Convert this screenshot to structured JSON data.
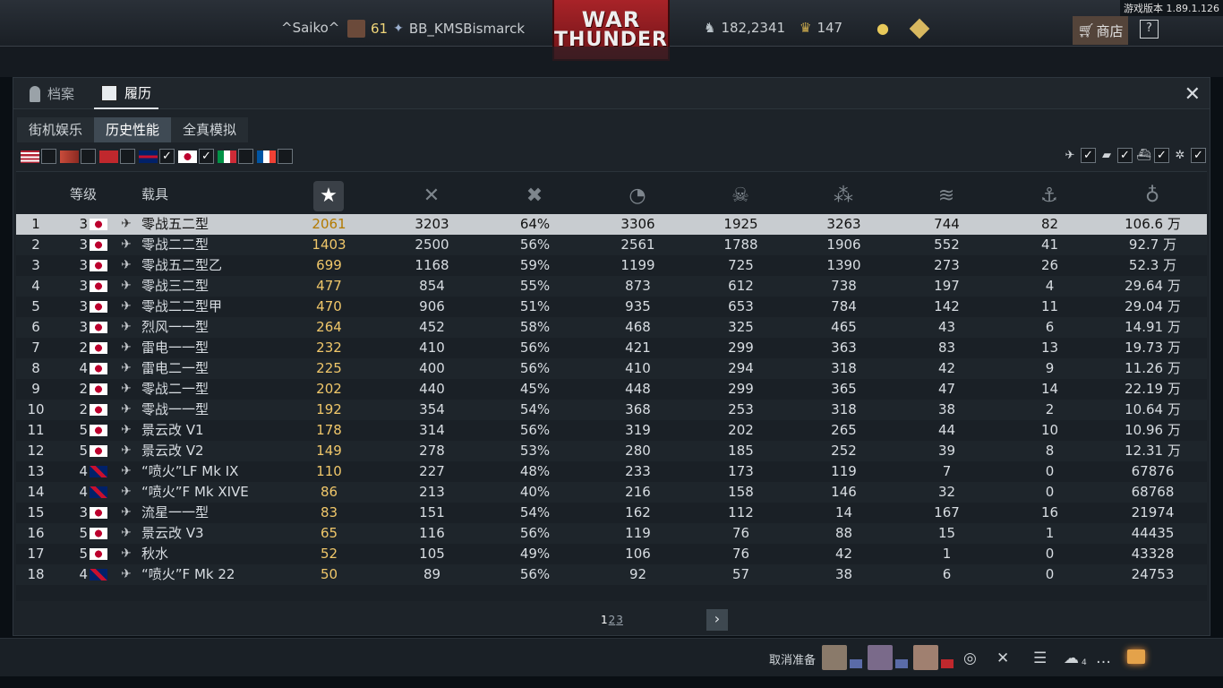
{
  "version": "游戏版本 1.89.1.126",
  "topbar": {
    "nickname": "^Saiko^",
    "rank": "61",
    "player_name": "BB_KMSBismarck",
    "logo_line1": "WAR",
    "logo_line2": "THUNDER",
    "silver": "182,2341",
    "gold": "147",
    "shop_label": "商店",
    "help_label": "?"
  },
  "window": {
    "tabs": [
      "档案",
      "履历"
    ],
    "active_tab": "履历",
    "close_label": "✕",
    "modes": [
      "街机娱乐",
      "历史性能",
      "全真模拟"
    ],
    "active_mode": "历史性能",
    "nation_filters": [
      {
        "icon": "usa-flag-icon",
        "checked": false
      },
      {
        "icon": "germany-flag-icon",
        "checked": false
      },
      {
        "icon": "ussr-flag-icon",
        "checked": false
      },
      {
        "icon": "uk-flag-icon",
        "checked": true
      },
      {
        "icon": "japan-flag-icon",
        "checked": true
      },
      {
        "icon": "italy-flag-icon",
        "checked": false
      },
      {
        "icon": "france-flag-icon",
        "checked": false
      }
    ],
    "type_filters": [
      {
        "icon": "aircraft-icon",
        "checked": true
      },
      {
        "icon": "tank-icon",
        "checked": true
      },
      {
        "icon": "ship-icon",
        "checked": true
      },
      {
        "icon": "helicopter-icon",
        "checked": true
      }
    ],
    "check_glyph": "✓",
    "headers": {
      "tier": "等级",
      "vehicle": "载具",
      "columns": [
        "battles-icon",
        "respawns-icon",
        "victories-pct-icon",
        "flights-icon",
        "deaths-icon",
        "air-kills-icon",
        "ground-kills-icon",
        "naval-kills-icon",
        "score-icon"
      ]
    },
    "rows": [
      {
        "idx": "1",
        "tier": "3",
        "nation": "japan",
        "name": "零战五二型",
        "v": [
          "2061",
          "3203",
          "64%",
          "3306",
          "1925",
          "3263",
          "744",
          "82",
          "106.6 万"
        ]
      },
      {
        "idx": "2",
        "tier": "3",
        "nation": "japan",
        "name": "零战二二型",
        "v": [
          "1403",
          "2500",
          "56%",
          "2561",
          "1788",
          "1906",
          "552",
          "41",
          "92.7 万"
        ]
      },
      {
        "idx": "3",
        "tier": "3",
        "nation": "japan",
        "name": "零战五二型乙",
        "v": [
          "699",
          "1168",
          "59%",
          "1199",
          "725",
          "1390",
          "273",
          "26",
          "52.3 万"
        ]
      },
      {
        "idx": "4",
        "tier": "3",
        "nation": "japan",
        "name": "零战三二型",
        "v": [
          "477",
          "854",
          "55%",
          "873",
          "612",
          "738",
          "197",
          "4",
          "29.64 万"
        ]
      },
      {
        "idx": "5",
        "tier": "3",
        "nation": "japan",
        "name": "零战二二型甲",
        "v": [
          "470",
          "906",
          "51%",
          "935",
          "653",
          "784",
          "142",
          "11",
          "29.04 万"
        ]
      },
      {
        "idx": "6",
        "tier": "3",
        "nation": "japan",
        "name": "烈风一一型",
        "v": [
          "264",
          "452",
          "58%",
          "468",
          "325",
          "465",
          "43",
          "6",
          "14.91 万"
        ]
      },
      {
        "idx": "7",
        "tier": "2",
        "nation": "japan",
        "name": "雷电一一型",
        "v": [
          "232",
          "410",
          "56%",
          "421",
          "299",
          "363",
          "83",
          "13",
          "19.73 万"
        ]
      },
      {
        "idx": "8",
        "tier": "4",
        "nation": "japan",
        "name": "雷电二一型",
        "v": [
          "225",
          "400",
          "56%",
          "410",
          "294",
          "318",
          "42",
          "9",
          "11.26 万"
        ]
      },
      {
        "idx": "9",
        "tier": "2",
        "nation": "japan",
        "name": "零战二一型",
        "v": [
          "202",
          "440",
          "45%",
          "448",
          "299",
          "365",
          "47",
          "14",
          "22.19 万"
        ]
      },
      {
        "idx": "10",
        "tier": "2",
        "nation": "japan",
        "name": "零战一一型",
        "v": [
          "192",
          "354",
          "54%",
          "368",
          "253",
          "318",
          "38",
          "2",
          "10.64 万"
        ]
      },
      {
        "idx": "11",
        "tier": "5",
        "nation": "japan",
        "name": "景云改 V1",
        "v": [
          "178",
          "314",
          "56%",
          "319",
          "202",
          "265",
          "44",
          "10",
          "10.96 万"
        ]
      },
      {
        "idx": "12",
        "tier": "5",
        "nation": "japan",
        "name": "景云改 V2",
        "v": [
          "149",
          "278",
          "53%",
          "280",
          "185",
          "252",
          "39",
          "8",
          "12.31 万"
        ]
      },
      {
        "idx": "13",
        "tier": "4",
        "nation": "uk",
        "name": "“喷火”LF Mk IX",
        "v": [
          "110",
          "227",
          "48%",
          "233",
          "173",
          "119",
          "7",
          "0",
          "67876"
        ]
      },
      {
        "idx": "14",
        "tier": "4",
        "nation": "uk",
        "name": "“喷火”F Mk XIVE",
        "v": [
          "86",
          "213",
          "40%",
          "216",
          "158",
          "146",
          "32",
          "0",
          "68768"
        ]
      },
      {
        "idx": "15",
        "tier": "3",
        "nation": "japan",
        "name": "流星一一型",
        "v": [
          "83",
          "151",
          "54%",
          "162",
          "112",
          "14",
          "167",
          "16",
          "21974"
        ]
      },
      {
        "idx": "16",
        "tier": "5",
        "nation": "japan",
        "name": "景云改 V3",
        "v": [
          "65",
          "116",
          "56%",
          "119",
          "76",
          "88",
          "15",
          "1",
          "44435"
        ]
      },
      {
        "idx": "17",
        "tier": "5",
        "nation": "japan",
        "name": "秋水",
        "v": [
          "52",
          "105",
          "49%",
          "106",
          "76",
          "42",
          "1",
          "0",
          "43328"
        ]
      },
      {
        "idx": "18",
        "tier": "4",
        "nation": "uk",
        "name": "“喷火”F Mk 22",
        "v": [
          "50",
          "89",
          "56%",
          "92",
          "57",
          "38",
          "6",
          "0",
          "24753"
        ]
      }
    ],
    "pager": {
      "current": "1",
      "pages": [
        "2",
        "3"
      ],
      "next_label": "›"
    }
  },
  "bottom": {
    "cancel_ready": "取消准备",
    "mail_count": "4"
  },
  "colors": {
    "accent_battles": "#f0c76a",
    "shop_bg": "#54443a",
    "logo_red": "#a82328"
  }
}
